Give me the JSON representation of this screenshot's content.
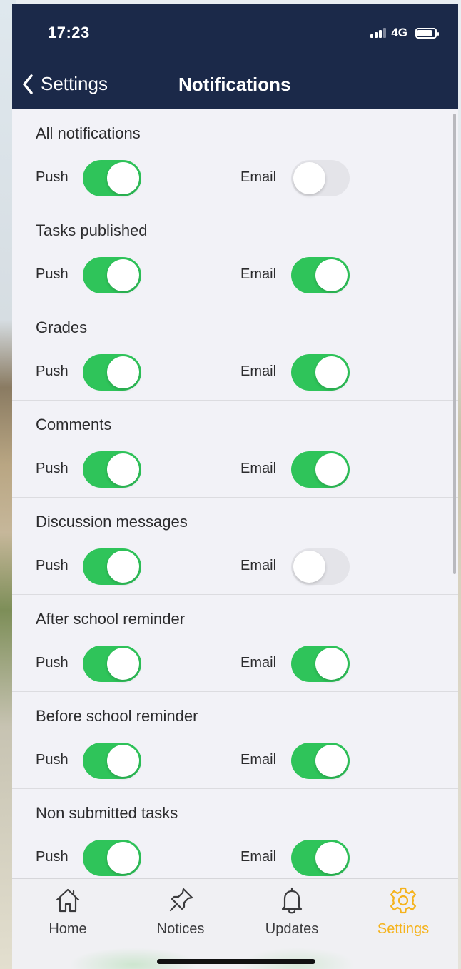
{
  "status_bar": {
    "time": "17:23",
    "network": "4G"
  },
  "header": {
    "back_label": "Settings",
    "title": "Notifications"
  },
  "sections": [
    {
      "title": "All notifications",
      "push_label": "Push",
      "email_label": "Email",
      "push": true,
      "email": false
    },
    {
      "title": "Tasks published",
      "push_label": "Push",
      "email_label": "Email",
      "push": true,
      "email": true
    },
    {
      "title": "Grades",
      "push_label": "Push",
      "email_label": "Email",
      "push": true,
      "email": true
    },
    {
      "title": "Comments",
      "push_label": "Push",
      "email_label": "Email",
      "push": true,
      "email": true
    },
    {
      "title": "Discussion messages",
      "push_label": "Push",
      "email_label": "Email",
      "push": true,
      "email": false
    },
    {
      "title": "After school reminder",
      "push_label": "Push",
      "email_label": "Email",
      "push": true,
      "email": true
    },
    {
      "title": "Before school reminder",
      "push_label": "Push",
      "email_label": "Email",
      "push": true,
      "email": true
    },
    {
      "title": "Non submitted tasks",
      "push_label": "Push",
      "email_label": "Email",
      "push": true,
      "email": true
    }
  ],
  "tabbar": {
    "tabs": [
      {
        "label": "Home",
        "icon": "home-icon"
      },
      {
        "label": "Notices",
        "icon": "pin-icon"
      },
      {
        "label": "Updates",
        "icon": "bell-icon"
      },
      {
        "label": "Settings",
        "icon": "gear-icon",
        "active": true
      }
    ]
  },
  "colors": {
    "header_bg": "#1b2949",
    "toggle_on": "#2fc45a",
    "toggle_off": "#e4e4e9",
    "active_tab": "#f5b31c"
  }
}
